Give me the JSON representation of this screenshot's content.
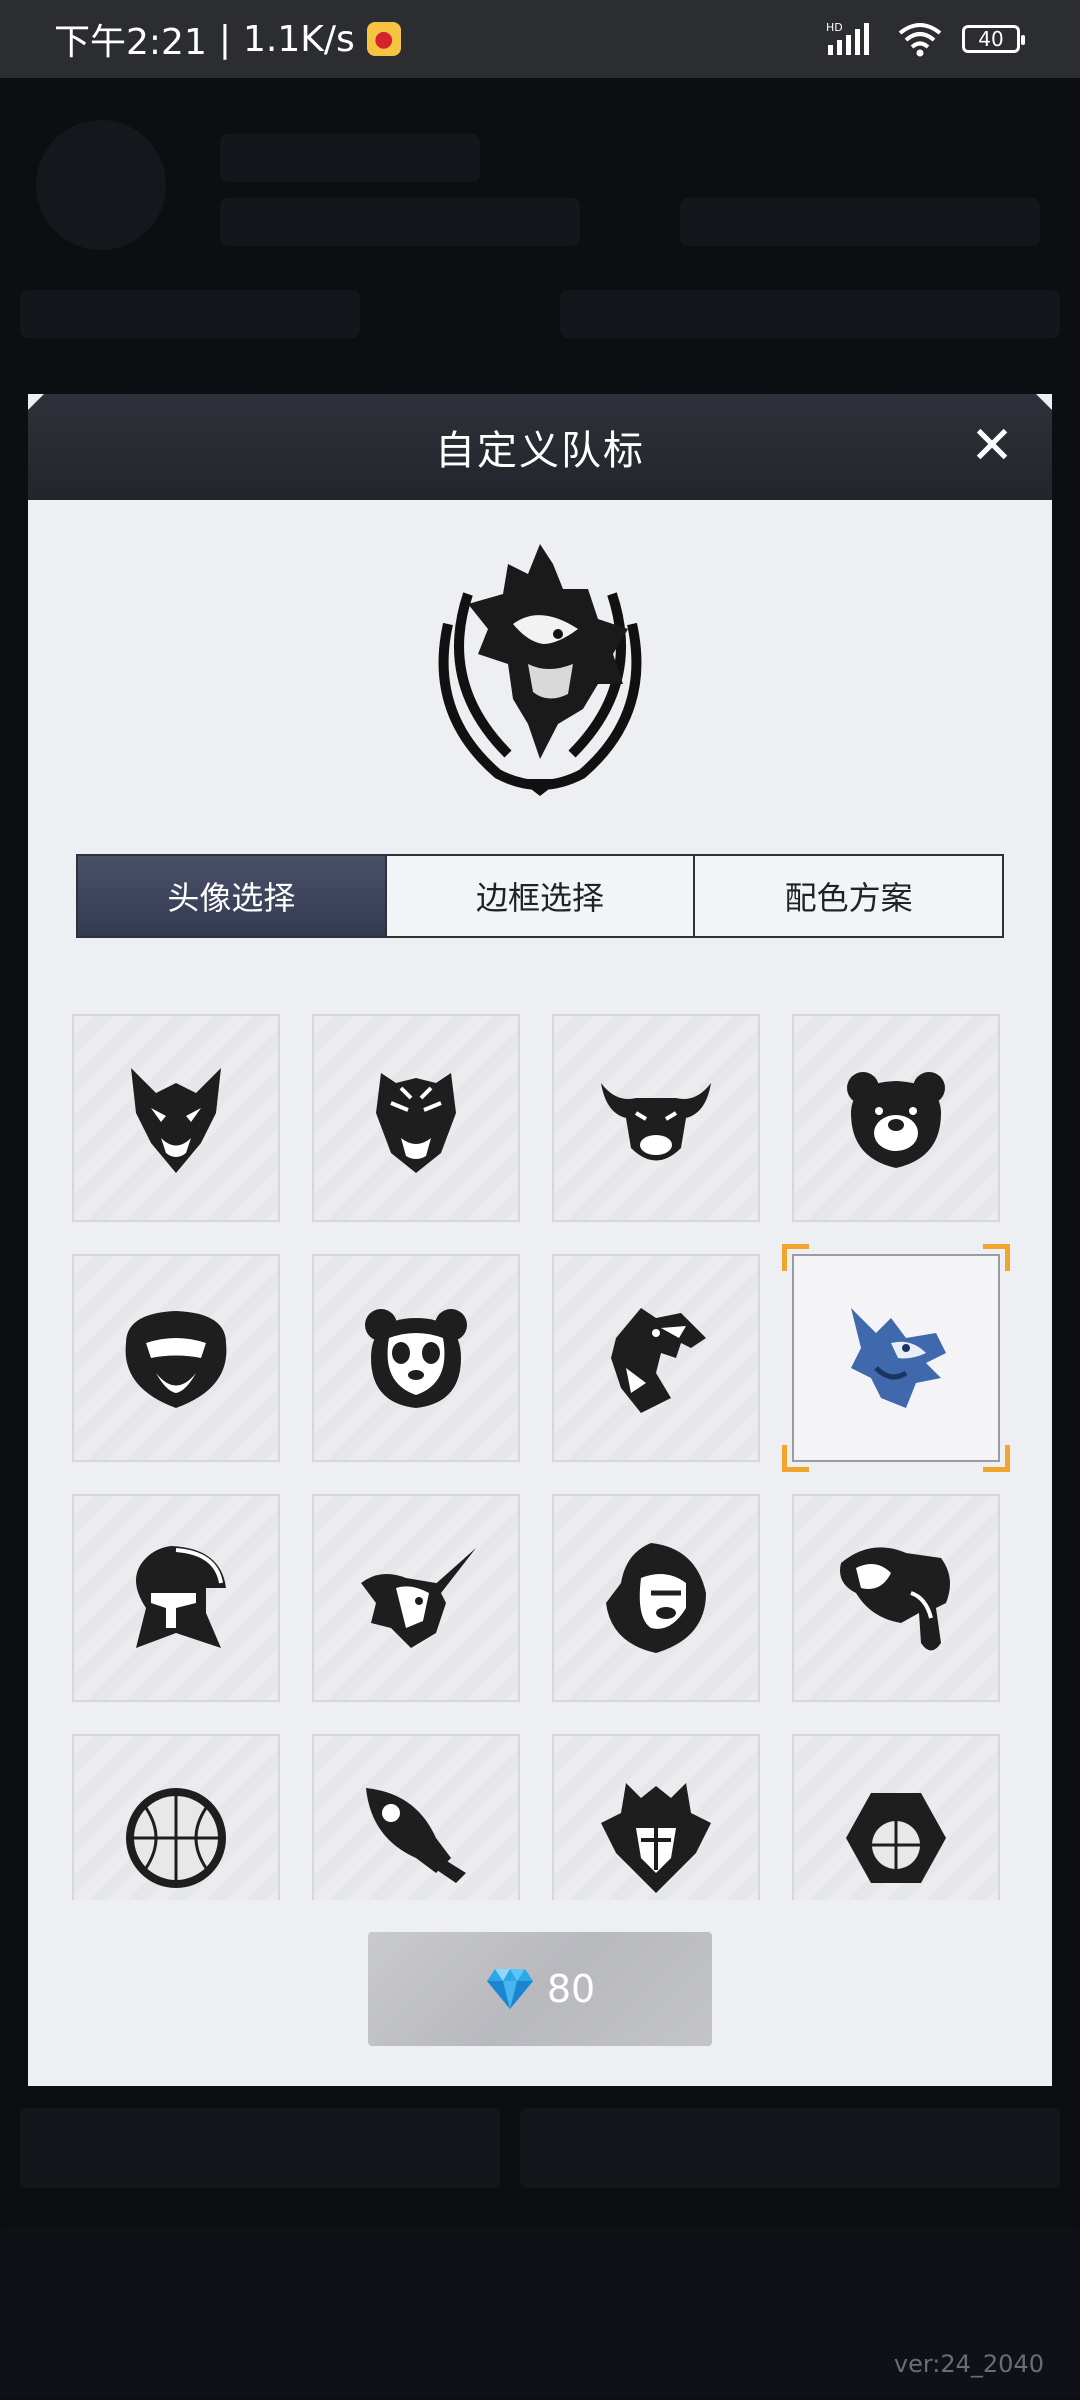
{
  "status_bar": {
    "time": "下午2:21",
    "network_speed": "1.1K/s",
    "separator": "|",
    "battery": "40",
    "hd_label": "HD"
  },
  "modal": {
    "title": "自定义队标",
    "close_icon": "close-icon",
    "preview_icon": "dragon-crest-icon",
    "tabs": [
      {
        "label": "头像选择",
        "active": true
      },
      {
        "label": "边框选择",
        "active": false
      },
      {
        "label": "配色方案",
        "active": false
      }
    ],
    "icons": [
      {
        "name": "wolf-icon",
        "selected": false
      },
      {
        "name": "tiger-icon",
        "selected": false
      },
      {
        "name": "bull-icon",
        "selected": false
      },
      {
        "name": "bear-icon",
        "selected": false
      },
      {
        "name": "monkey-icon",
        "selected": false
      },
      {
        "name": "panda-icon",
        "selected": false
      },
      {
        "name": "eagle-icon",
        "selected": false
      },
      {
        "name": "dragon-icon",
        "selected": true
      },
      {
        "name": "spartan-helmet-icon",
        "selected": false
      },
      {
        "name": "unicorn-icon",
        "selected": false
      },
      {
        "name": "gorilla-icon",
        "selected": false
      },
      {
        "name": "elephant-icon",
        "selected": false
      },
      {
        "name": "basketball-icon",
        "selected": false
      },
      {
        "name": "rocket-icon",
        "selected": false
      },
      {
        "name": "knight-helmet-icon",
        "selected": false
      },
      {
        "name": "hexagon-basketball-icon",
        "selected": false
      }
    ],
    "price": {
      "icon": "diamond-icon",
      "amount": "80"
    }
  },
  "footer": {
    "version": "ver:24_2040"
  },
  "colors": {
    "accent_orange": "#f0a52c",
    "tab_active": "#3c4259",
    "header_dark": "#2a2d34",
    "selected_icon_blue": "#4a74b8"
  }
}
